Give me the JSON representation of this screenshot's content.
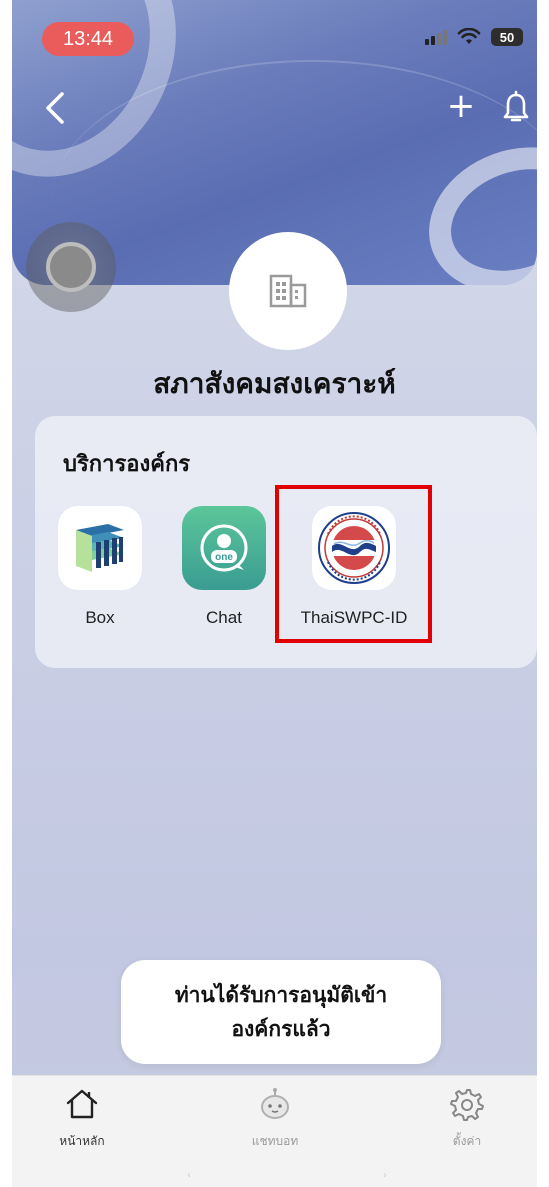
{
  "status_bar": {
    "time": "13:44",
    "battery": "50",
    "icons": [
      "signal-icon",
      "wifi-icon",
      "battery-icon"
    ]
  },
  "header": {
    "back_icon": "back-arrow-icon",
    "add_label": "+",
    "bell_icon": "bell-icon"
  },
  "organization": {
    "icon": "building-icon",
    "name": "สภาสังคมสงเคราะห์"
  },
  "services": {
    "title": "บริการองค์กร",
    "apps": [
      {
        "label": "Box",
        "icon": "box-app-icon"
      },
      {
        "label": "Chat",
        "icon": "chat-app-icon",
        "badge_text": "one"
      },
      {
        "label": "ThaiSWPC-ID",
        "icon": "thaiswpc-logo-icon"
      }
    ]
  },
  "toast": {
    "line1": "ท่านได้รับการอนุมัติเข้า",
    "line2": "องค์กรแล้ว"
  },
  "tabbar": {
    "tabs": [
      {
        "label": "หน้าหลัก",
        "icon": "home-icon",
        "active": true
      },
      {
        "label": "แชทบอท",
        "icon": "chatbot-icon",
        "active": false
      },
      {
        "label": "ตั้งค่า",
        "icon": "gear-icon",
        "active": false
      }
    ]
  },
  "colors": {
    "highlight": "#e00000",
    "time_pill": "#ea5c5c",
    "hero": "#6a7cbb"
  }
}
